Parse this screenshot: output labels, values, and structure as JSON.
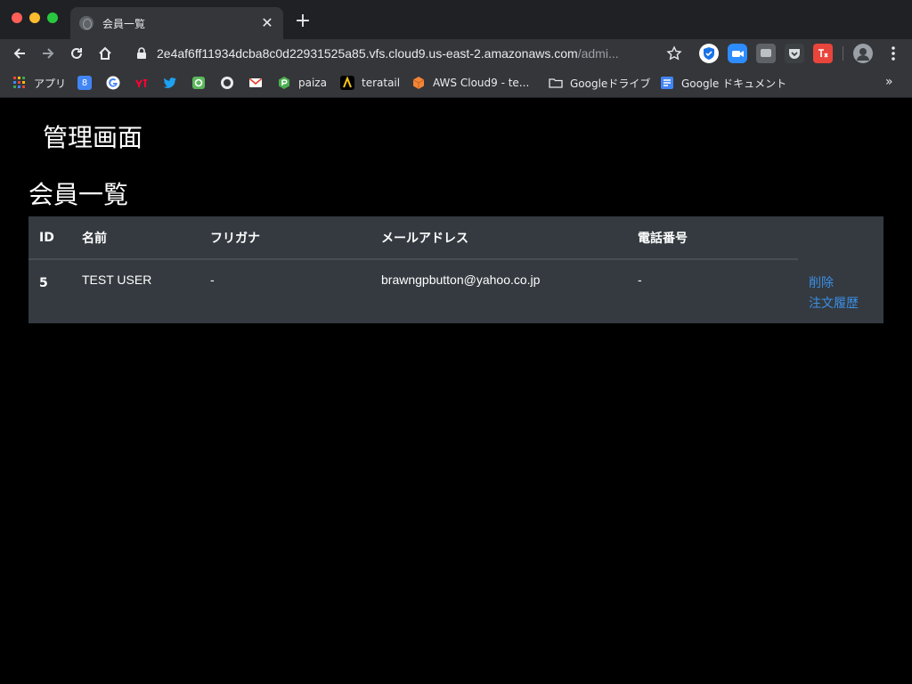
{
  "browser": {
    "tab_title": "会員一覧",
    "tab_close": "✕",
    "new_tab": "+",
    "url_main": "2e4af6ff11934dcba8c0d22931525a85.vfs.cloud9.us-east-2.amazonaws.com",
    "url_dim": "/admi...",
    "bookmarks": [
      {
        "label": "アプリ"
      },
      {
        "label": ""
      },
      {
        "label": ""
      },
      {
        "label": ""
      },
      {
        "label": ""
      },
      {
        "label": ""
      },
      {
        "label": ""
      },
      {
        "label": ""
      },
      {
        "label": "paiza"
      },
      {
        "label": "teratail"
      },
      {
        "label": "AWS Cloud9 - te..."
      },
      {
        "label": "Googleドライブ"
      },
      {
        "label": "Google ドキュメント"
      }
    ],
    "bookmarks_overflow": "»",
    "calendar_number": "8"
  },
  "page": {
    "admin_title": "管理画面",
    "section_title": "会員一覧",
    "table": {
      "headers": [
        "ID",
        "名前",
        "フリガナ",
        "メールアドレス",
        "電話番号",
        ""
      ],
      "rows": [
        {
          "id": "5",
          "name": "TEST USER",
          "furigana": "-",
          "email": "brawngpbutton@yahoo.co.jp",
          "phone": "-",
          "delete_label": "削除",
          "history_label": "注文履歴"
        }
      ]
    }
  },
  "colors": {
    "link": "#3b8fe5",
    "table_bg": "#343a40",
    "page_bg": "#000000"
  }
}
